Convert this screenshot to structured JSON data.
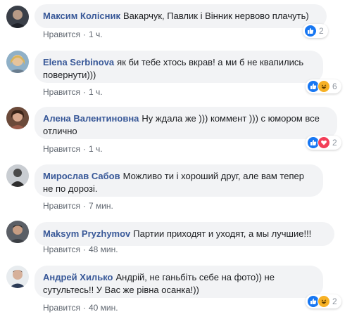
{
  "colors": {
    "author": "#385898",
    "bubble": "#f2f3f5",
    "meta": "#606770",
    "like": "#1877f2",
    "haha": "#f7b125",
    "love": "#f33e58"
  },
  "comments": [
    {
      "author": "Максим Колісник",
      "text": "Вакарчук, Павлик і Вінник нервово плачуть)",
      "like_label": "Нравится",
      "time": "1 ч.",
      "reactions": [
        "like-icon"
      ],
      "reaction_count": "2"
    },
    {
      "author": "Elena Serbinova",
      "text": "як би тебе хтось вкрав! а ми б не квапились повернути)))",
      "like_label": "Нравится",
      "time": "1 ч.",
      "reactions": [
        "like-icon",
        "haha-icon"
      ],
      "reaction_count": "6"
    },
    {
      "author": "Алена Валентиновна",
      "text": "Ну ждала же ))) коммент ))) с юмором все отлично",
      "like_label": "Нравится",
      "time": "1 ч.",
      "reactions": [
        "like-icon",
        "love-icon"
      ],
      "reaction_count": "2"
    },
    {
      "author": "Мирослав Сабов",
      "text": "Можливо ти і хороший друг, але вам тепер не по дорозі.",
      "like_label": "Нравится",
      "time": "7 мин."
    },
    {
      "author": "Maksym Pryzhymov",
      "text": "Партии приходят и уходят, а мы лучшие!!!",
      "like_label": "Нравится",
      "time": "48 мин."
    },
    {
      "author": "Андрей Хилько",
      "text": "Андрій, не ганьбіть себе на фото)) не сутультесь!! У Вас же рівна осанка!))",
      "like_label": "Нравится",
      "time": "40 мин.",
      "reactions": [
        "like-icon",
        "haha-icon"
      ],
      "reaction_count": "2"
    }
  ]
}
